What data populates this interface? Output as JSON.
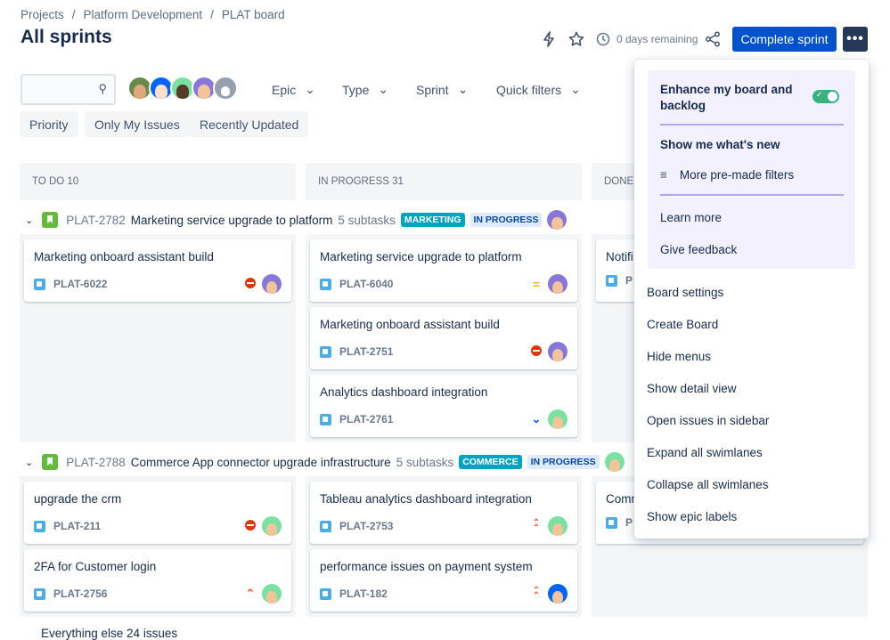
{
  "breadcrumb": [
    "Projects",
    "/",
    "Platform Development",
    "/",
    "PLAT board"
  ],
  "title": "All sprints",
  "header": {
    "days_remaining": "0 days remaining",
    "complete_sprint": "Complete sprint",
    "more": "•••"
  },
  "filters": {
    "search_placeholder": "",
    "epic": "Epic",
    "type": "Type",
    "sprint": "Sprint",
    "quick_filters": "Quick filters",
    "chips": [
      "Priority",
      "Only My Issues",
      "Recently Updated"
    ]
  },
  "columns": [
    {
      "title": "TO DO 10"
    },
    {
      "title": "IN PROGRESS 31"
    },
    {
      "title": "DONE"
    }
  ],
  "swimlanes": [
    {
      "key": "PLAT-2782",
      "title": "Marketing service upgrade to platform",
      "subtasks": "5 subtasks",
      "label": "MARKETING",
      "status": "IN PROGRESS",
      "todo": [
        {
          "title": "Marketing onboard assistant build",
          "key": "PLAT-6022",
          "priority": "blocker"
        }
      ],
      "inprogress": [
        {
          "title": "Marketing service upgrade to platform",
          "key": "PLAT-6040",
          "priority": "medium"
        },
        {
          "title": "Marketing onboard assistant build",
          "key": "PLAT-2751",
          "priority": "blocker"
        },
        {
          "title": "Analytics dashboard integration",
          "key": "PLAT-2761",
          "priority": "low"
        }
      ],
      "done": [
        {
          "title": "Notifi",
          "key": "P"
        }
      ]
    },
    {
      "key": "PLAT-2788",
      "title": "Commerce App connector upgrade infrastructure",
      "subtasks": "5 subtasks",
      "label": "COMMERCE",
      "status": "IN PROGRESS",
      "todo": [
        {
          "title": "upgrade the crm",
          "key": "PLAT-211",
          "priority": "blocker"
        },
        {
          "title": "2FA for Customer login",
          "key": "PLAT-2756",
          "priority": "high"
        }
      ],
      "inprogress": [
        {
          "title": "Tableau analytics dashboard integration",
          "key": "PLAT-2753",
          "priority": "highest"
        },
        {
          "title": "performance issues on payment system",
          "key": "PLAT-182",
          "priority": "highest"
        }
      ],
      "done": [
        {
          "title": "Comm",
          "key": "P"
        }
      ]
    }
  ],
  "footer": "Everything else  24 issues",
  "menu": {
    "enhance": "Enhance my board and backlog",
    "whats_new": "Show me what's new",
    "premade": "More pre-made filters",
    "learn": "Learn more",
    "feedback": "Give feedback",
    "items": [
      "Board settings",
      "Create Board",
      "Hide menus",
      "Show detail view",
      "Open issues in sidebar",
      "Expand all swimlanes",
      "Collapse all swimlanes",
      "Show epic labels"
    ]
  },
  "colors": {
    "primary": "#0052cc",
    "epic_label": "#00a3bf",
    "status_bg": "#deebff",
    "status_fg": "#0747a6",
    "toggle": "#36b37e"
  }
}
